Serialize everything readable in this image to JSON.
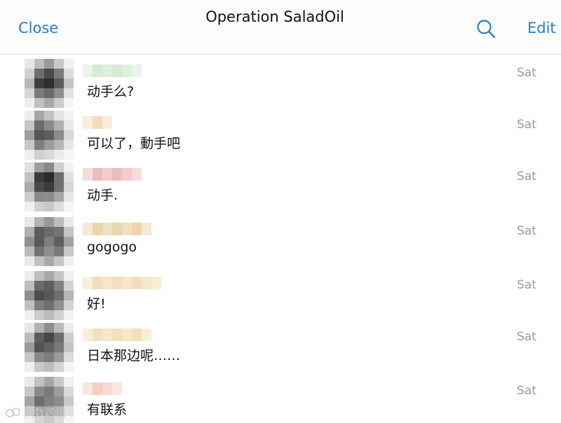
{
  "nav": {
    "close_label": "Close",
    "title": "Operation SaladOil",
    "search_icon": "search-icon",
    "edit_label": "Edit",
    "accent_color": "#2a7ec6"
  },
  "messages": [
    {
      "text": "动手么?",
      "time": "Sat",
      "sender_color": "#cfe8cc",
      "avatar": [
        "#e6e6e6",
        "#bdbdbd",
        "#9a9a9a",
        "#c8c8c8",
        "#f0f0f0",
        "#d0d0d0",
        "#6e6e6e",
        "#4a4a4a",
        "#7a7a7a",
        "#dcdcdc",
        "#b8b8b8",
        "#3d3d3d",
        "#2e2e2e",
        "#5a5a5a",
        "#c4c4c4",
        "#d6d6d6",
        "#7c7c7c",
        "#6a6a6a",
        "#8e8e8e",
        "#e2e2e2",
        "#efefef",
        "#c0c0c0",
        "#a8a8a8",
        "#cccccc",
        "#f4f4f4"
      ]
    },
    {
      "text": "可以了，動手吧",
      "time": "Sat",
      "sender_color": "#efd7ac",
      "avatar": [
        "#ededed",
        "#a6a6a6",
        "#c2c2c2",
        "#e4e4e4",
        "#f3f3f3",
        "#c6c6c6",
        "#6c6c6c",
        "#8a8a8a",
        "#b0b0b0",
        "#e8e8e8",
        "#a0a0a0",
        "#555555",
        "#5e5e5e",
        "#8c8c8c",
        "#d8d8d8",
        "#c8c8c8",
        "#7e7e7e",
        "#9c9c9c",
        "#b6b6b6",
        "#e6e6e6",
        "#eeeeee",
        "#cfcfcf",
        "#dadada",
        "#ececec",
        "#f6f6f6"
      ]
    },
    {
      "text": "动手.",
      "time": "Sat",
      "sender_color": "#eab0b4",
      "avatar": [
        "#e0e0e0",
        "#9e9e9e",
        "#8a8a8a",
        "#cfcfcf",
        "#f2f2f2",
        "#c2c2c2",
        "#3a3a3a",
        "#2a2a2a",
        "#6e6e6e",
        "#e0e0e0",
        "#aaaaaa",
        "#4a4a4a",
        "#3c3c3c",
        "#707070",
        "#d6d6d6",
        "#cccccc",
        "#8a8a8a",
        "#8c8c8c",
        "#a6a6a6",
        "#e6e6e6",
        "#f0f0f0",
        "#d0d0d0",
        "#c8c8c8",
        "#dedede",
        "#f6f6f6"
      ]
    },
    {
      "text": "gogogo",
      "time": "Sat",
      "sender_color": "#e6cf9e",
      "avatar": [
        "#e8e8e8",
        "#b4b4b4",
        "#989898",
        "#bcbcbc",
        "#eaeaea",
        "#b0b0b0",
        "#5c5c5c",
        "#6a6a6a",
        "#727272",
        "#c4c4c4",
        "#909090",
        "#5a5a5a",
        "#7e7e7e",
        "#5e5e5e",
        "#a2a2a2",
        "#bababa",
        "#727272",
        "#8e8e8e",
        "#7a7a7a",
        "#c8c8c8",
        "#eaeaea",
        "#c2c2c2",
        "#a8a8a8",
        "#c6c6c6",
        "#f0f0f0"
      ]
    },
    {
      "text": "好!",
      "time": "Sat",
      "sender_color": "#efd9b0",
      "avatar": [
        "#ececec",
        "#bfbfbf",
        "#a8a8a8",
        "#c6c6c6",
        "#f0f0f0",
        "#bebebe",
        "#6a6a6a",
        "#5e5e5e",
        "#828282",
        "#d2d2d2",
        "#8e8e8e",
        "#4e4e4e",
        "#585858",
        "#6e6e6e",
        "#b6b6b6",
        "#c0c0c0",
        "#7e7e7e",
        "#707070",
        "#909090",
        "#d4d4d4",
        "#eeeeee",
        "#cccccc",
        "#bcbcbc",
        "#d2d2d2",
        "#f4f4f4"
      ]
    },
    {
      "text": "日本那边呢……",
      "time": "Sat",
      "sender_color": "#f0dcb0",
      "avatar": [
        "#e6e6e6",
        "#b2b2b2",
        "#8e8e8e",
        "#b8b8b8",
        "#ececec",
        "#bcbcbc",
        "#5c5c5c",
        "#464646",
        "#6e6e6e",
        "#cecece",
        "#9a9a9a",
        "#525252",
        "#626262",
        "#7a7a7a",
        "#c4c4c4",
        "#c6c6c6",
        "#888888",
        "#7c7c7c",
        "#9a9a9a",
        "#dcdcdc",
        "#eeeeee",
        "#cacaca",
        "#bdbdbd",
        "#d4d4d4",
        "#f4f4f4"
      ]
    },
    {
      "text": "有联系",
      "time": "Sat",
      "sender_color": "#f2c8b8",
      "avatar": [
        "#eaeaea",
        "#c2c2c2",
        "#a6a6a6",
        "#c8c8c8",
        "#f0f0f0",
        "#c6c6c6",
        "#8a8a8a",
        "#7a7a7a",
        "#9e9e9e",
        "#dadada",
        "#a4a4a4",
        "#6e6e6e",
        "#808080",
        "#8c8c8c",
        "#cacaca",
        "#cccccc",
        "#9c9c9c",
        "#a0a0a0",
        "#b0b0b0",
        "#e0e0e0",
        "#f0f0f0",
        "#d6d6d6",
        "#cacaca",
        "#dcdcdc",
        "#f6f6f6"
      ]
    }
  ],
  "watermark": {
    "label": "大数跨境"
  }
}
